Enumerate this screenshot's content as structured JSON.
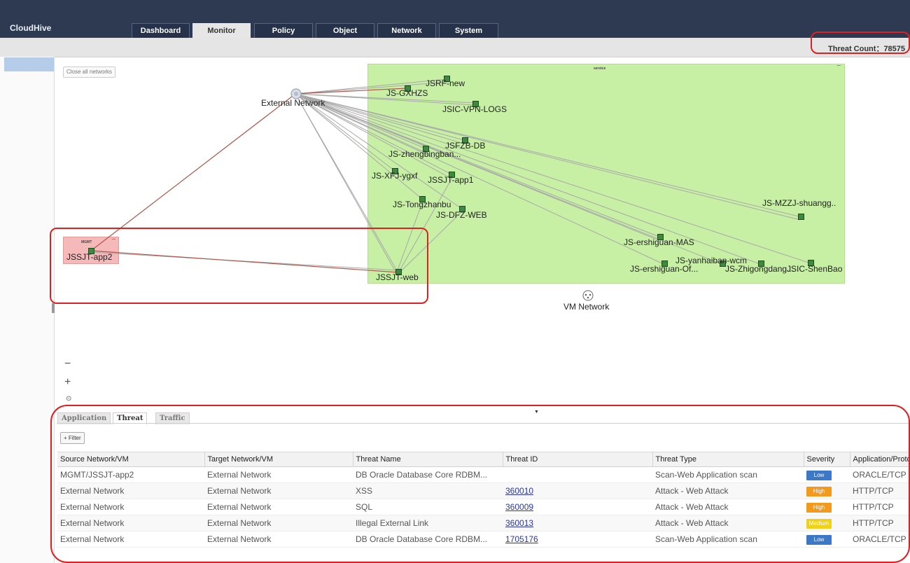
{
  "app": {
    "brand": "CloudHive"
  },
  "nav": {
    "tabs": [
      {
        "label": "Dashboard",
        "active": false
      },
      {
        "label": "Monitor",
        "active": true
      },
      {
        "label": "Policy",
        "active": false
      },
      {
        "label": "Object",
        "active": false
      },
      {
        "label": "Network",
        "active": false
      },
      {
        "label": "System",
        "active": false
      }
    ]
  },
  "status": {
    "threat_count": "Threat Count：78575"
  },
  "topology": {
    "close_all_label": "Close all networks",
    "service_group_label": "service",
    "mgmt_group_label": "MGMT",
    "minimize_symbol": "−",
    "external_network_label": "External Network",
    "vm_network_label": "VM Network",
    "nodes": {
      "jsrf_new": "JSRF-new",
      "js_gxhzs": "JS-GXHZS",
      "jsic_vpn_logs": "JSIC-VPN-LOGS",
      "jsfzb_db": "JSFZB-DB",
      "js_zhengbingban": "JS-zhengbingban...",
      "js_xfj_ygxf": "JS-XFJ-ygxf",
      "jssjt_app1": "JSSJT-app1",
      "js_tongzhanbu": "JS-Tongzhanbu",
      "js_dfz_web": "JS-DFZ-WEB",
      "js_mzzj_shuangg": "JS-MZZJ-shuangg..",
      "js_ershiguan_mas": "JS-ershiguan-MAS",
      "js_ershiguan_of": "JS-ershiguan-Of...",
      "js_yanhaiban_wcm": "JS-yanhaiban-wcm",
      "js_zhigongdang": "JS-Zhigongdang...",
      "jsic_shenbao": "JSIC-ShenBao",
      "jssjt_web": "JSSJT-web",
      "jssjt_app2": "JSSJT-app2"
    },
    "zoom_out": "−",
    "zoom_in": "+",
    "fit": "⊙",
    "drag_handle": "▼"
  },
  "panel": {
    "tabs": [
      {
        "label": "Application",
        "active": false
      },
      {
        "label": "Threat",
        "active": true
      },
      {
        "label": "Traffic",
        "active": false
      }
    ],
    "filter_label": "+ Filter",
    "columns": [
      "Source Network/VM",
      "Target Network/VM",
      "Threat Name",
      "Threat ID",
      "Threat Type",
      "Severity",
      "Application/Protocol"
    ],
    "rows": [
      {
        "source": "MGMT/JSSJT-app2",
        "target": "External Network",
        "threat_name": "DB Oracle Database Core RDBM...",
        "threat_id": "",
        "threat_type": "Scan-Web Application scan",
        "severity": "Low",
        "app": "ORACLE/TCP"
      },
      {
        "source": "External Network",
        "target": "External Network",
        "threat_name": "XSS",
        "threat_id": "360010",
        "threat_type": "Attack - Web Attack",
        "severity": "High",
        "app": "HTTP/TCP"
      },
      {
        "source": "External Network",
        "target": "External Network",
        "threat_name": "SQL",
        "threat_id": "360009",
        "threat_type": "Attack - Web Attack",
        "severity": "High",
        "app": "HTTP/TCP"
      },
      {
        "source": "External Network",
        "target": "External Network",
        "threat_name": "Illegal External Link",
        "threat_id": "360013",
        "threat_type": "Attack - Web Attack",
        "severity": "Medium",
        "app": "HTTP/TCP"
      },
      {
        "source": "External Network",
        "target": "External Network",
        "threat_name": "DB Oracle Database Core RDBM...",
        "threat_id": "1705176",
        "threat_type": "Scan-Web Application scan",
        "severity": "Low",
        "app": "ORACLE/TCP"
      }
    ]
  },
  "colors": {
    "low": "#3b78c7",
    "high": "#f39a1d",
    "medium": "#f1d01a",
    "accent_red": "#e02020",
    "service_zone": "#c7f0a5",
    "mgmt_zone": "#f5b9b9",
    "topbar": "#2d3a52"
  }
}
